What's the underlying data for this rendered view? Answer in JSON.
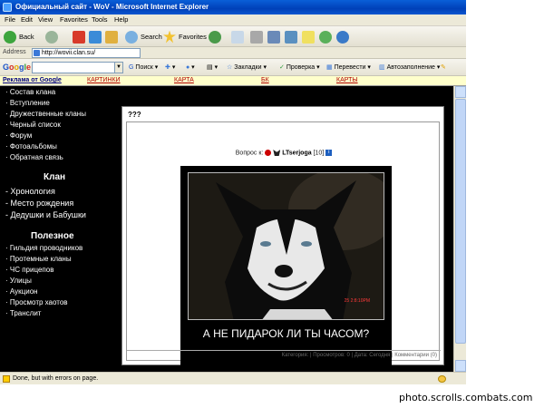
{
  "window": {
    "title": "Официальный сайт - WoV - Microsoft Internet Explorer"
  },
  "menu": [
    "File",
    "Edit",
    "View",
    "Favorites",
    "Tools",
    "Help"
  ],
  "toolbar": {
    "back_label": "Back",
    "search_label": "Search",
    "favorites_label": "Favorites"
  },
  "address": {
    "label": "Address",
    "url": "http://wovii.clan.su/"
  },
  "googlebar": {
    "logo": "Google",
    "search_value": "",
    "search_label": "Поиск",
    "bookmarks_label": "Закладки",
    "check_label": "Проверка",
    "translate_label": "Перевести",
    "autofill_label": "Автозаполнение"
  },
  "links_bar": {
    "ads": "Реклама от Google",
    "items": [
      "КАРТИНКИ",
      "КАРТА",
      "БК",
      "КАРТЫ"
    ]
  },
  "sidebar": {
    "main": [
      "Состав клана",
      "Вступление",
      "Дружественные кланы",
      "Черный список",
      "Форум",
      "Фотоальбомы",
      "Обратная связь"
    ],
    "clan_title": "Клан",
    "clan": [
      "Хронология",
      "Место рождения",
      "Дедушки и Бабушки"
    ],
    "useful_title": "Полезное",
    "useful": [
      "Гильдия проводников",
      "Протемные кланы",
      "ЧС прицепов",
      "Улицы",
      "Аукцион",
      "Просмотр хаотов",
      "Транслит"
    ]
  },
  "post": {
    "title": "???",
    "question_to": "Вопрос к:",
    "user": "LTserjoga",
    "level": "[10]",
    "info_badge": "i",
    "caption": "А НЕ ПИДАРОК ЛИ ТЫ ЧАСОМ?",
    "photo_stamp": "25  2:8:10PM",
    "meta": "Категория: | Просмотров: 0 | Дата: Сегодня | Комментарии (0)"
  },
  "status": {
    "text": "Done, but with errors on page."
  },
  "watermark": "photo.scrolls.combats.com",
  "colors": {
    "title_bar": "#0a5fd8",
    "page_bg": "#000000",
    "links_bar_bg": "#ffffcc",
    "link_text": "#b00000"
  }
}
